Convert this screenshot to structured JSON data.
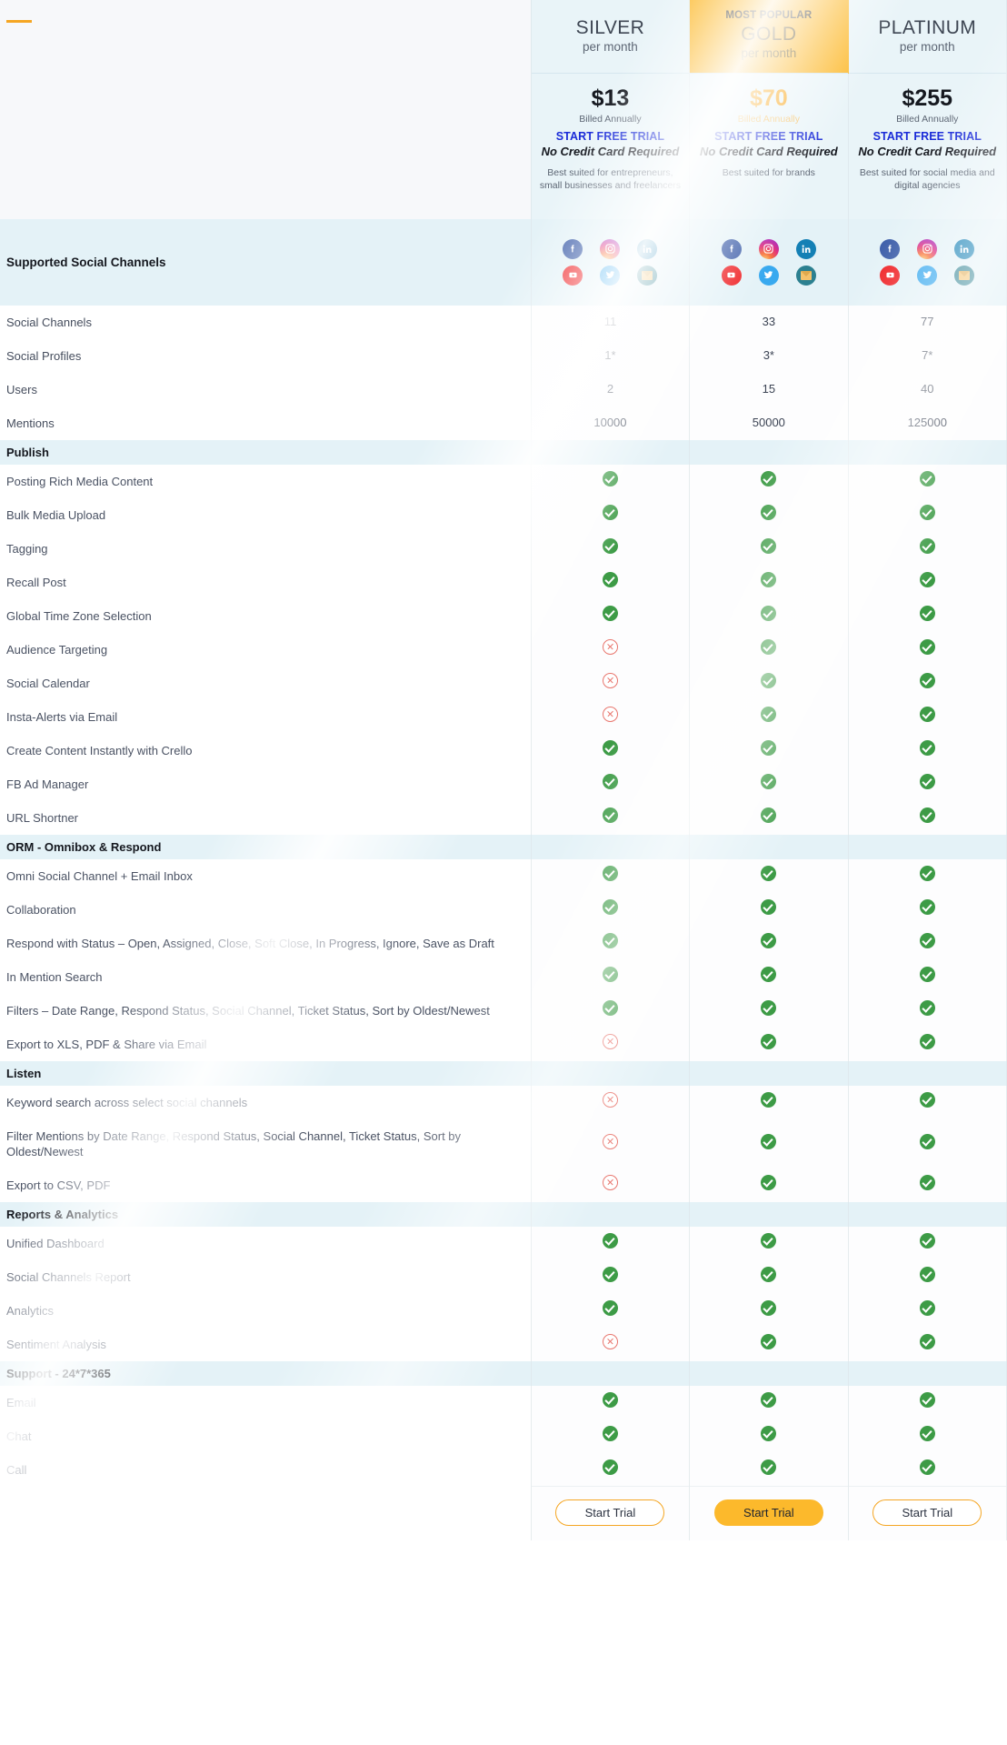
{
  "brand": {
    "accent_orange": "#f5a623",
    "gold": "#fcb92c",
    "check_green": "#3d9b46",
    "cross_red": "#e8766e",
    "link_blue": "#1a2bd8"
  },
  "plans": [
    {
      "badge": "",
      "name": "SILVER",
      "per": "per month",
      "price": "$13",
      "billed": "Billed Annually",
      "cta_link": "START FREE TRIAL",
      "no_card": "No Credit Card Required",
      "best_suited": "Best suited for entrepreneurs, small businesses and freelancers",
      "trial_button": "Start Trial",
      "highlight": false
    },
    {
      "badge": "MOST POPULAR",
      "name": "GOLD",
      "per": "per month",
      "price": "$70",
      "billed": "Billed Annually",
      "cta_link": "START FREE TRIAL",
      "no_card": "No Credit Card Required",
      "best_suited": "Best suited for brands",
      "trial_button": "Start Trial",
      "highlight": true
    },
    {
      "badge": "",
      "name": "PLATINUM",
      "per": "per month",
      "price": "$255",
      "billed": "Billed Annually",
      "cta_link": "START FREE TRIAL",
      "no_card": "No Credit Card Required",
      "best_suited": "Best suited for social media and digital agencies",
      "trial_button": "Start Trial",
      "highlight": false
    }
  ],
  "social_channels_row": {
    "label": "Supported Social Channels",
    "icons_row_1": [
      "facebook-icon",
      "instagram-icon",
      "linkedin-icon"
    ],
    "icons_row_2": [
      "youtube-icon",
      "twitter-icon",
      "email-icon"
    ]
  },
  "quantitative_rows": [
    {
      "label": "Social Channels",
      "values": [
        "11",
        "33",
        "77"
      ]
    },
    {
      "label": "Social Profiles",
      "values": [
        "1*",
        "3*",
        "7*"
      ]
    },
    {
      "label": "Users",
      "values": [
        "2",
        "15",
        "40"
      ]
    },
    {
      "label": "Mentions",
      "values": [
        "10000",
        "50000",
        "125000"
      ]
    }
  ],
  "sections": [
    {
      "title": "Publish",
      "rows": [
        {
          "label": "Posting Rich Media Content",
          "values": [
            "check",
            "check",
            "check"
          ]
        },
        {
          "label": "Bulk Media Upload",
          "values": [
            "check",
            "check",
            "check"
          ]
        },
        {
          "label": "Tagging",
          "values": [
            "check",
            "check",
            "check"
          ]
        },
        {
          "label": "Recall Post",
          "values": [
            "check",
            "check",
            "check"
          ]
        },
        {
          "label": "Global Time Zone Selection",
          "values": [
            "check",
            "check",
            "check"
          ]
        },
        {
          "label": "Audience Targeting",
          "values": [
            "cross",
            "check",
            "check"
          ]
        },
        {
          "label": "Social Calendar",
          "values": [
            "cross",
            "check",
            "check"
          ]
        },
        {
          "label": "Insta-Alerts via Email",
          "values": [
            "cross",
            "check",
            "check"
          ]
        },
        {
          "label": "Create Content Instantly with Crello",
          "values": [
            "check",
            "check",
            "check"
          ]
        },
        {
          "label": "FB Ad Manager",
          "values": [
            "check",
            "check",
            "check"
          ]
        },
        {
          "label": "URL Shortner",
          "values": [
            "check",
            "check",
            "check"
          ]
        }
      ]
    },
    {
      "title": "ORM - Omnibox & Respond",
      "rows": [
        {
          "label": "Omni Social Channel + Email Inbox",
          "values": [
            "check",
            "check",
            "check"
          ]
        },
        {
          "label": "Collaboration",
          "values": [
            "check",
            "check",
            "check"
          ]
        },
        {
          "label": "Respond with Status – Open, Assigned, Close, Soft Close, In Progress, Ignore, Save as Draft",
          "values": [
            "check",
            "check",
            "check"
          ]
        },
        {
          "label": "In Mention Search",
          "values": [
            "check",
            "check",
            "check"
          ]
        },
        {
          "label": "Filters – Date Range, Respond Status, Social Channel, Ticket Status, Sort by Oldest/Newest",
          "values": [
            "check",
            "check",
            "check"
          ]
        },
        {
          "label": "Export to XLS, PDF & Share via Email",
          "values": [
            "cross",
            "check",
            "check"
          ]
        }
      ]
    },
    {
      "title": "Listen",
      "rows": [
        {
          "label": "Keyword search across select social channels",
          "values": [
            "cross",
            "check",
            "check"
          ]
        },
        {
          "label": "Filter Mentions by Date Range, Respond Status, Social Channel, Ticket Status, Sort by Oldest/Newest",
          "values": [
            "cross",
            "check",
            "check"
          ]
        },
        {
          "label": "Export to CSV, PDF",
          "values": [
            "cross",
            "check",
            "check"
          ]
        }
      ]
    },
    {
      "title": "Reports & Analytics",
      "rows": [
        {
          "label": "Unified Dashboard",
          "values": [
            "check",
            "check",
            "check"
          ]
        },
        {
          "label": "Social Channels Report",
          "values": [
            "check",
            "check",
            "check"
          ]
        },
        {
          "label": "Analytics",
          "values": [
            "check",
            "check",
            "check"
          ]
        },
        {
          "label": "Sentiment Analysis",
          "values": [
            "cross",
            "check",
            "check"
          ]
        }
      ]
    },
    {
      "title": "Support - 24*7*365",
      "rows": [
        {
          "label": "Email",
          "values": [
            "check",
            "check",
            "check"
          ]
        },
        {
          "label": "Chat",
          "values": [
            "check",
            "check",
            "check"
          ]
        },
        {
          "label": "Call",
          "values": [
            "check",
            "check",
            "check"
          ]
        }
      ]
    }
  ]
}
